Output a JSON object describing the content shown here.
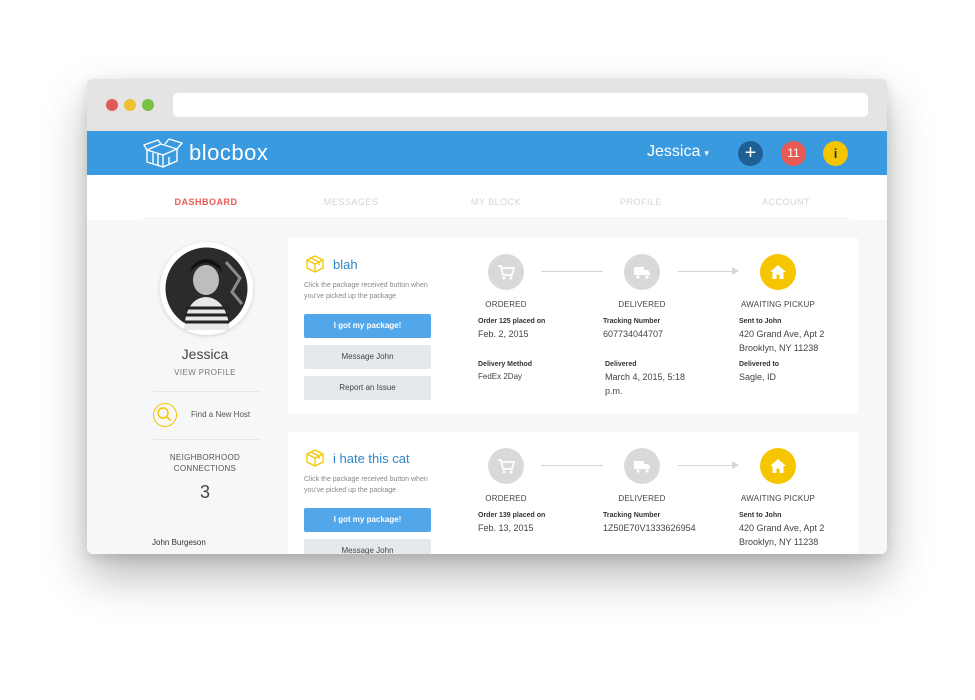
{
  "header": {
    "logo_text": "blocbox",
    "user_name": "Jessica",
    "caret": "▾",
    "add_glyph": "+",
    "notifications_count": "11",
    "info_glyph": "i",
    "colors": {
      "bar": "#3a9ae0",
      "add": "#1f5f96",
      "notifications": "#e85b54",
      "info": "#f5c500"
    }
  },
  "tabs": [
    {
      "label": "DASHBOARD",
      "active": true
    },
    {
      "label": "MESSAGES",
      "active": false
    },
    {
      "label": "MY BLOCK",
      "active": false
    },
    {
      "label": "PROFILE",
      "active": false
    },
    {
      "label": "ACCOUNT",
      "active": false
    }
  ],
  "sidebar": {
    "name": "Jessica",
    "view_profile": "VIEW PROFILE",
    "find_host": "Find a New Host",
    "connections_label_1": "NEIGHBORHOOD",
    "connections_label_2": "CONNECTIONS",
    "connections_count": "3",
    "neighbor_name": "John Burgeson"
  },
  "orders": [
    {
      "title": "blah",
      "hint": "Click the package received button when you've picked up the package",
      "buttons": {
        "received": "I got my package!",
        "message": "Message John",
        "report": "Report an Issue"
      },
      "steps": {
        "ordered": "ORDERED",
        "delivered": "DELIVERED",
        "pickup": "AWAITING PICKUP"
      },
      "order_label": "Order 125 placed on",
      "order_date": "Feb. 2, 2015",
      "tracking_label": "Tracking Number",
      "tracking_number": "607734044707",
      "sent_label": "Sent to John",
      "address_1": "420 Grand Ave, Apt 2",
      "address_2": "Brooklyn, NY 11238",
      "method_label": "Delivery Method",
      "method_value": "FedEx 2Day",
      "delivered_label": "Delivered",
      "delivered_value_1": "March 4, 2015, 5:18",
      "delivered_value_2": "p.m.",
      "delivered_to_label": "Delivered to",
      "delivered_to_value": "Sagle, ID"
    },
    {
      "title": "i hate this cat",
      "hint": "Click the package received button when you've picked up the package",
      "buttons": {
        "received": "I got my package!",
        "message": "Message John"
      },
      "steps": {
        "ordered": "ORDERED",
        "delivered": "DELIVERED",
        "pickup": "AWAITING PICKUP"
      },
      "order_label": "Order 139 placed on",
      "order_date": "Feb. 13, 2015",
      "tracking_label": "Tracking Number",
      "tracking_number": "1Z50E70V1333626954",
      "sent_label": "Sent to John",
      "address_1": "420 Grand Ave, Apt 2",
      "address_2": "Brooklyn, NY 11238"
    }
  ]
}
